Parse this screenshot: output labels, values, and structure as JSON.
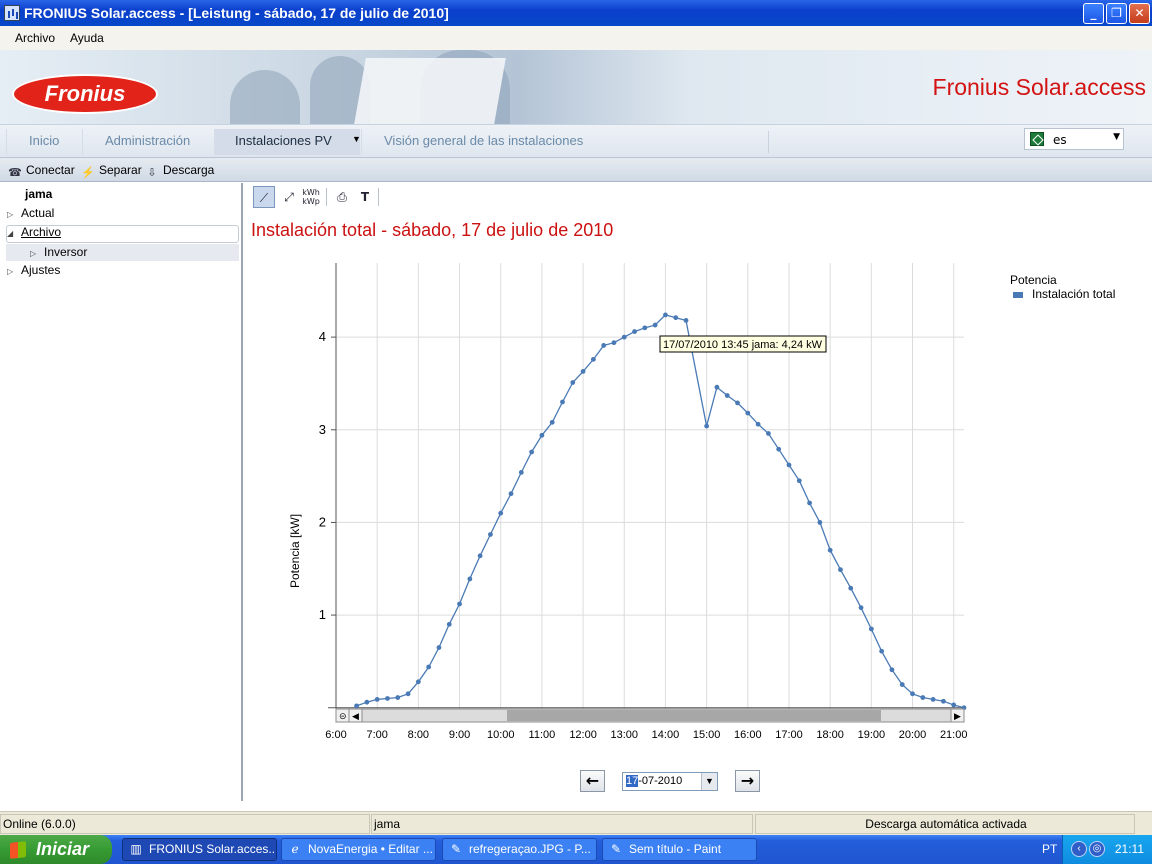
{
  "window": {
    "title": "FRONIUS Solar.access - [Leistung - sábado, 17 de julio de 2010]",
    "minimize_glyph": "_",
    "maximize_glyph": "❐",
    "close_glyph": "✕"
  },
  "menu": {
    "items": [
      {
        "label": "Archivo"
      },
      {
        "label": "Ayuda"
      }
    ]
  },
  "banner": {
    "logo_text": "Fronius",
    "brand_title": "Fronius Solar.access"
  },
  "nav": {
    "tabs": [
      {
        "label": "Inicio"
      },
      {
        "label": "Administración"
      },
      {
        "label": "Instalaciones PV"
      },
      {
        "label": "Visión general de las instalaciones"
      }
    ],
    "language_value": "es"
  },
  "toolbar": {
    "items": [
      {
        "label": "Conectar"
      },
      {
        "label": "Separar"
      },
      {
        "label": "Descarga"
      }
    ]
  },
  "tree": {
    "root": "jama",
    "items": [
      {
        "label": "Actual"
      },
      {
        "label": "Archivo"
      },
      {
        "label": "Inversor"
      },
      {
        "label": "Ajustes"
      }
    ]
  },
  "chart_tools": {
    "kwh_label_top": "kWh",
    "kwh_label_bottom": "kWp",
    "text_tool": "T"
  },
  "chart_title": "Instalación total - sábado, 17 de julio de 2010",
  "tooltip": "17/07/2010 13:45 jama: 4,24 kW",
  "chart_data": {
    "type": "line",
    "title": "Instalación total - sábado, 17 de julio de 2010",
    "ylabel": "Potencia [kW]",
    "xlabel": "",
    "ylim": [
      -0.1,
      4.8
    ],
    "xlim": [
      "6:00",
      "21:15"
    ],
    "y_ticks": [
      1,
      2,
      3,
      4
    ],
    "x_ticks": [
      "6:00",
      "7:00",
      "8:00",
      "9:00",
      "10:00",
      "11:00",
      "12:00",
      "13:00",
      "14:00",
      "15:00",
      "16:00",
      "17:00",
      "18:00",
      "19:00",
      "20:00",
      "21:00"
    ],
    "grid": true,
    "legend": {
      "title": "Potencia",
      "position": "top-right"
    },
    "series": [
      {
        "name": "Instalación total",
        "color": "#4a7ab5",
        "x": [
          "6:30",
          "6:45",
          "7:00",
          "7:15",
          "7:30",
          "7:45",
          "8:00",
          "8:15",
          "8:30",
          "8:45",
          "9:00",
          "9:15",
          "9:30",
          "9:45",
          "10:00",
          "10:15",
          "10:30",
          "10:45",
          "11:00",
          "11:15",
          "11:30",
          "11:45",
          "12:00",
          "12:15",
          "12:30",
          "12:45",
          "13:00",
          "13:15",
          "13:30",
          "13:45",
          "14:00",
          "14:15",
          "14:30",
          "15:00",
          "15:15",
          "15:30",
          "15:45",
          "16:00",
          "16:15",
          "16:30",
          "16:45",
          "17:00",
          "17:15",
          "17:30",
          "17:45",
          "18:00",
          "18:15",
          "18:30",
          "18:45",
          "19:00",
          "19:15",
          "19:30",
          "19:45",
          "20:00",
          "20:15",
          "20:30",
          "20:45",
          "21:00",
          "21:15"
        ],
        "values": [
          0.02,
          0.06,
          0.09,
          0.1,
          0.11,
          0.15,
          0.28,
          0.44,
          0.65,
          0.9,
          1.12,
          1.39,
          1.64,
          1.87,
          2.1,
          2.31,
          2.54,
          2.76,
          2.94,
          3.08,
          3.3,
          3.51,
          3.63,
          3.76,
          3.91,
          3.94,
          4.0,
          4.06,
          4.1,
          4.13,
          4.24,
          4.21,
          4.18,
          3.04,
          3.46,
          3.37,
          3.29,
          3.18,
          3.06,
          2.96,
          2.79,
          2.62,
          2.45,
          2.21,
          2.0,
          1.7,
          1.49,
          1.29,
          1.08,
          0.85,
          0.61,
          0.41,
          0.25,
          0.15,
          0.11,
          0.09,
          0.07,
          0.03,
          0.0
        ]
      }
    ]
  },
  "date_nav": {
    "prev": "←",
    "next": "→",
    "date_highlight": "17",
    "date_rest": "-07-2010"
  },
  "status": {
    "left": "Online (6.0.0)",
    "middle": "jama",
    "right": "Descarga automática activada"
  },
  "taskbar": {
    "start_label": "Iniciar",
    "buttons": [
      {
        "label": "FRONIUS Solar.acces..."
      },
      {
        "label": "NovaEnergia • Editar ..."
      },
      {
        "label": "refregeraçao.JPG - P..."
      },
      {
        "label": "Sem título - Paint"
      }
    ],
    "lang": "PT",
    "clock": "21:11"
  }
}
